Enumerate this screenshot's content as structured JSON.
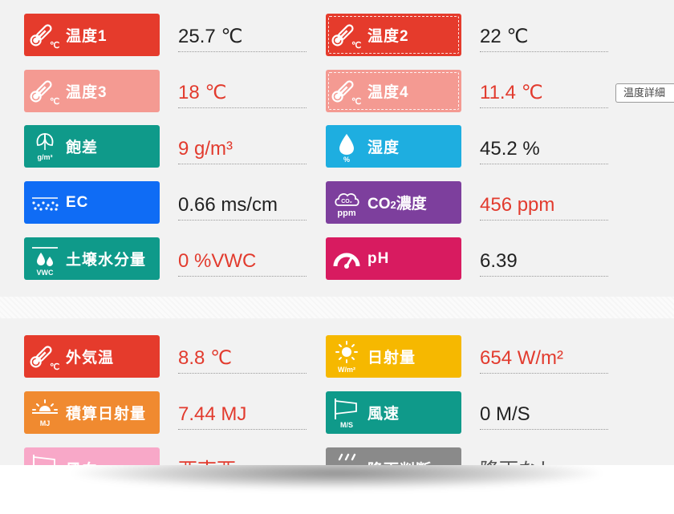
{
  "colors": {
    "red": "#e53b2c",
    "pink": "#f49a92",
    "teal": "#0f9a8a",
    "sky": "#1eaee0",
    "blue": "#0f6cf5",
    "purple": "#7d3f9d",
    "magenta": "#d81b60",
    "yellow": "#f6b800",
    "orange": "#f08a30",
    "lightpink": "#f8a8c8",
    "gray": "#8a8a8a",
    "value_red": "#e23b2e",
    "value_dark": "#222222"
  },
  "detail_button": {
    "label": "温度詳細"
  },
  "panel1": {
    "items": [
      {
        "label": "温度1",
        "value": "25.7 ℃",
        "icon": "thermometer-icon"
      },
      {
        "label": "温度2",
        "value": "22 ℃",
        "icon": "thermometer-icon"
      },
      {
        "label": "温度3",
        "value": "18 ℃",
        "icon": "thermometer-icon"
      },
      {
        "label": "温度4",
        "value": "11.4 ℃",
        "icon": "thermometer-icon"
      },
      {
        "label": "飽差",
        "value": "9 g/m³",
        "icon": "leaf-icon",
        "unit": "g/m³"
      },
      {
        "label": "湿度",
        "value": "45.2 %",
        "icon": "droplet-icon",
        "unit": "%"
      },
      {
        "label": "EC",
        "value": "0.66 ms/cm",
        "icon": "dots-icon"
      },
      {
        "label": "CO2濃度",
        "label_main": "CO",
        "label_sub": "2",
        "label_rest": "濃度",
        "value": "456 ppm",
        "icon": "cloud-icon",
        "unit": "ppm",
        "cloud_text": "CO₂"
      },
      {
        "label": "土壌水分量",
        "value": "0 %VWC",
        "icon": "soil-moisture-icon",
        "unit": "VWC"
      },
      {
        "label": "pH",
        "value": "6.39",
        "icon": "gauge-icon"
      }
    ]
  },
  "panel2": {
    "items": [
      {
        "label": "外気温",
        "value": "8.8 ℃",
        "icon": "thermometer-icon"
      },
      {
        "label": "日射量",
        "value": "654 W/m²",
        "icon": "sun-icon",
        "unit": "W/m²"
      },
      {
        "label": "積算日射量",
        "value": "7.44 MJ",
        "icon": "sun-horizon-icon",
        "unit": "MJ"
      },
      {
        "label": "風速",
        "value": "0 M/S",
        "icon": "windsock-icon",
        "unit": "M/S"
      },
      {
        "label": "風向",
        "value": "西南西",
        "icon": "windsock-icon"
      },
      {
        "label": "降雨判断",
        "value": "降雨なし",
        "icon": "rain-icon"
      }
    ]
  }
}
